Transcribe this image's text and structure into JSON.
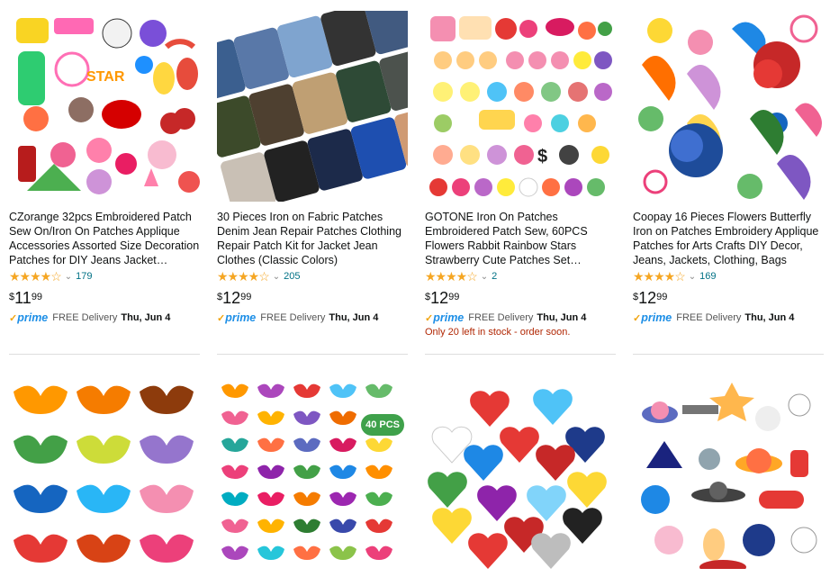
{
  "products": [
    {
      "title": "CZorange 32pcs Embroidered Patch Sew On/Iron On Patches Applique Accessories Assorted Size Decoration Patches for DIY Jeans Jacket Clothing…",
      "stars": "★★★★☆",
      "count": "179",
      "currency": "$",
      "whole": "11",
      "fraction": "99",
      "prime": "prime",
      "delivery_text": "FREE Delivery",
      "delivery_date": "Thu, Jun 4",
      "stock": ""
    },
    {
      "title": "30 Pieces Iron on Fabric Patches Denim Jean Repair Patches Clothing Repair Patch Kit for Jacket Jean Clothes (Classic Colors)",
      "stars": "★★★★☆",
      "count": "205",
      "currency": "$",
      "whole": "12",
      "fraction": "99",
      "prime": "prime",
      "delivery_text": "FREE Delivery",
      "delivery_date": "Thu, Jun 4",
      "stock": ""
    },
    {
      "title": "GOTONE Iron On Patches Embroidered Patch Sew, 60PCS Flowers Rabbit Rainbow Stars Strawberry Cute Patches Set Assorted Size Decoration…",
      "stars": "★★★★☆",
      "count": "2",
      "currency": "$",
      "whole": "12",
      "fraction": "99",
      "prime": "prime",
      "delivery_text": "FREE Delivery",
      "delivery_date": "Thu, Jun 4",
      "stock": "Only 20 left in stock - order soon."
    },
    {
      "title": "Coopay 16 Pieces Flowers Butterfly Iron on Patches Embroidery Applique Patches for Arts Crafts DIY Decor, Jeans, Jackets, Clothing, Bags",
      "stars": "★★★★☆",
      "count": "169",
      "currency": "$",
      "whole": "12",
      "fraction": "99",
      "prime": "prime",
      "delivery_text": "FREE Delivery",
      "delivery_date": "Thu, Jun 4",
      "stock": ""
    }
  ],
  "badge_40pcs": "40 PCS",
  "icons": {
    "check": "✓",
    "chevron": "⌄"
  },
  "colors": {
    "link": "#007185",
    "star": "#f5a623",
    "prime": "#1c8ee6",
    "stock": "#b12704"
  }
}
